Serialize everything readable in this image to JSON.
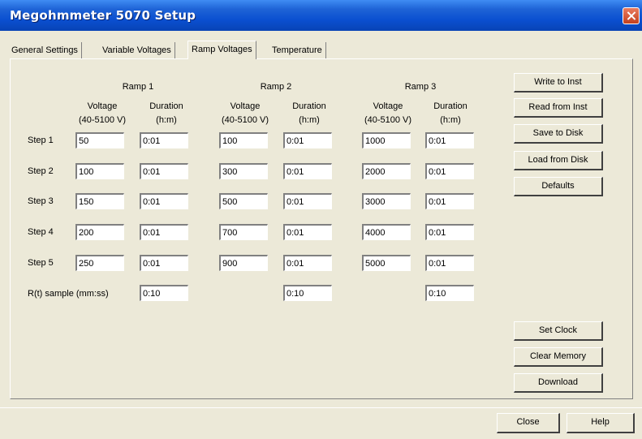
{
  "window": {
    "title": "Megohmmeter 5070 Setup"
  },
  "tabs": [
    "General Settings",
    "Variable Voltages",
    "Ramp Voltages",
    "Temperature"
  ],
  "active_tab": "Ramp Voltages",
  "ramps": [
    {
      "label": "Ramp 1",
      "voltage_header": "Voltage",
      "voltage_range": "(40-5100 V)",
      "duration_header": "Duration",
      "duration_unit": "(h:m)"
    },
    {
      "label": "Ramp 2",
      "voltage_header": "Voltage",
      "voltage_range": "(40-5100 V)",
      "duration_header": "Duration",
      "duration_unit": "(h:m)"
    },
    {
      "label": "Ramp 3",
      "voltage_header": "Voltage",
      "voltage_range": "(40-5100 V)",
      "duration_header": "Duration",
      "duration_unit": "(h:m)"
    }
  ],
  "step_labels": [
    "Step 1",
    "Step 2",
    "Step 3",
    "Step 4",
    "Step 5"
  ],
  "values": {
    "r1_v": [
      "50",
      "100",
      "150",
      "200",
      "250"
    ],
    "r1_d": [
      "0:01",
      "0:01",
      "0:01",
      "0:01",
      "0:01"
    ],
    "r2_v": [
      "100",
      "300",
      "500",
      "700",
      "900"
    ],
    "r2_d": [
      "0:01",
      "0:01",
      "0:01",
      "0:01",
      "0:01"
    ],
    "r3_v": [
      "1000",
      "2000",
      "3000",
      "4000",
      "5000"
    ],
    "r3_d": [
      "0:01",
      "0:01",
      "0:01",
      "0:01",
      "0:01"
    ]
  },
  "sample_label": "R(t) sample (mm:ss)",
  "sample_values": [
    "0:10",
    "0:10",
    "0:10"
  ],
  "buttons": {
    "write": "Write to Inst",
    "read": "Read from Inst",
    "save": "Save to Disk",
    "load": "Load from Disk",
    "defaults": "Defaults",
    "set_clock": "Set Clock",
    "clear_memory": "Clear Memory",
    "download": "Download",
    "close": "Close",
    "help": "Help"
  }
}
